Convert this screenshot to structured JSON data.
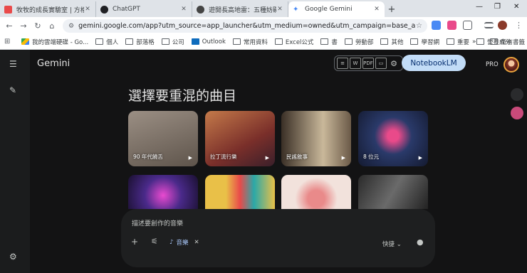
{
  "browser": {
    "tabs": [
      {
        "title": "牧牧的成長實驗室 | 方格子 vocus",
        "color": "#e94a4a"
      },
      {
        "title": "ChatGPT",
        "color": "#202124"
      },
      {
        "title": "遊開長高地雷：五種妨礙發育的",
        "color": "#444"
      },
      {
        "title": "Google Gemini",
        "color": "#4a8af4"
      }
    ],
    "url": "gemini.google.com/app?utm_source=app_launcher&utm_medium=owned&utm_campaign=base_all",
    "bookmarks": [
      "我的雲端硬碟 - Go...",
      "個人",
      "部落格",
      "公司",
      "Outlook",
      "常用資料",
      "Excel公式",
      "書",
      "勞動部",
      "其他",
      "學習網",
      "重要",
      "營養成分"
    ],
    "all_bookmarks": "所有書籤"
  },
  "app": {
    "logo": "Gemini",
    "notebooklm": "NotebookLM",
    "pro": "PRO",
    "tool_icons": [
      "doc",
      "W",
      "PDF",
      "slides"
    ],
    "heading": "選擇要重混的曲目",
    "cards": [
      {
        "label": "90 年代饒舌",
        "bg": "#7a6e63"
      },
      {
        "label": "拉丁流行樂",
        "bg": "#8a4a3a"
      },
      {
        "label": "民謠敘事",
        "bg": "#6b5a48"
      },
      {
        "label": "8 位元",
        "bg": "#1f2a4a"
      },
      {
        "label": "",
        "bg": "#3a1f4a"
      },
      {
        "label": "",
        "bg": "#c4a048"
      },
      {
        "label": "",
        "bg": "#e9cfc7"
      },
      {
        "label": "",
        "bg": "#3a3a3a"
      }
    ],
    "composer": {
      "placeholder": "描述要創作的音樂",
      "chip": "音樂",
      "mode": "快捷"
    }
  }
}
